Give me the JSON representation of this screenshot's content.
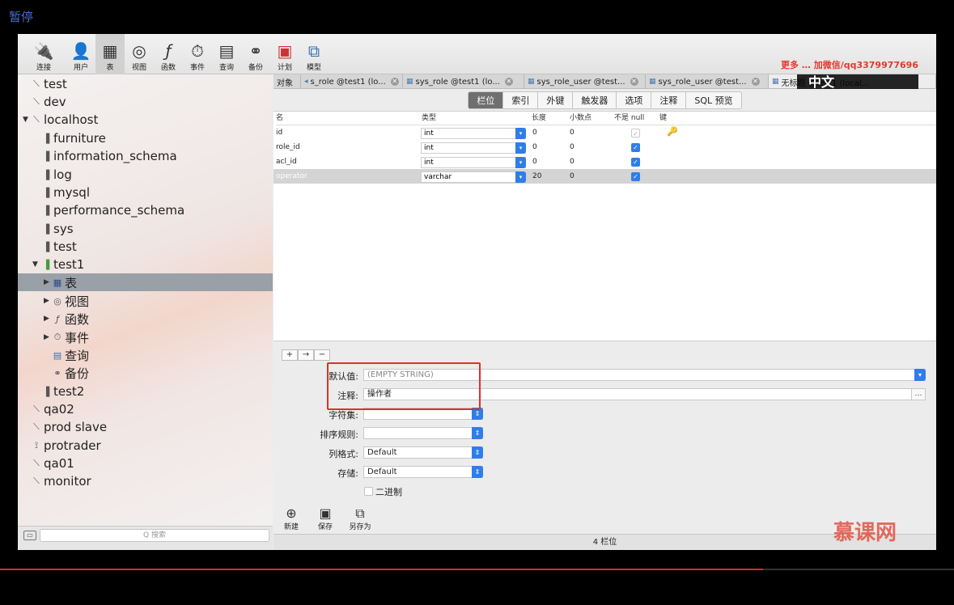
{
  "overlay": {
    "pause_label": "暂停",
    "progress": 0.8
  },
  "toolbar": {
    "items": [
      {
        "label": "连接",
        "icon": "connection-icon"
      },
      {
        "label": "用户",
        "icon": "user-icon"
      },
      {
        "label": "表",
        "icon": "table-icon"
      },
      {
        "label": "视图",
        "icon": "view-icon"
      },
      {
        "label": "函数",
        "icon": "function-icon"
      },
      {
        "label": "事件",
        "icon": "event-icon"
      },
      {
        "label": "查询",
        "icon": "query-icon"
      },
      {
        "label": "备份",
        "icon": "backup-icon"
      },
      {
        "label": "计划",
        "icon": "schedule-icon"
      },
      {
        "label": "模型",
        "icon": "model-icon"
      }
    ],
    "promo_text": "更多 … 加微信/qq3379977696"
  },
  "sidebar": {
    "items": [
      {
        "label": "test"
      },
      {
        "label": "dev"
      },
      {
        "label": "localhost"
      },
      {
        "label": "furniture"
      },
      {
        "label": "information_schema"
      },
      {
        "label": "log"
      },
      {
        "label": "mysql"
      },
      {
        "label": "performance_schema"
      },
      {
        "label": "sys"
      },
      {
        "label": "test"
      },
      {
        "label": "test1"
      },
      {
        "label": "表"
      },
      {
        "label": "视图"
      },
      {
        "label": "函数"
      },
      {
        "label": "事件"
      },
      {
        "label": "查询"
      },
      {
        "label": "备份"
      },
      {
        "label": "test2"
      },
      {
        "label": "qa02"
      },
      {
        "label": "prod slave"
      },
      {
        "label": "protrader"
      },
      {
        "label": "qa01"
      },
      {
        "label": "monitor"
      }
    ],
    "search_placeholder": "Q 搜索"
  },
  "tabs": [
    {
      "label": "对象"
    },
    {
      "label": "s_role @test1 (lo..."
    },
    {
      "label": "sys_role @test1 (lo..."
    },
    {
      "label": "sys_role_user @test..."
    },
    {
      "label": "sys_role_user @test..."
    },
    {
      "label": "无标题 @test1 (local..."
    }
  ],
  "badge": "中文",
  "segments": [
    "栏位",
    "索引",
    "外键",
    "触发器",
    "选项",
    "注释",
    "SQL 预览"
  ],
  "grid": {
    "headers": [
      "名",
      "类型",
      "长度",
      "小数点",
      "不是 null",
      "键"
    ],
    "rows": [
      {
        "name": "id",
        "type": "int",
        "length": "0",
        "decimals": "0",
        "not_null": true,
        "key": true
      },
      {
        "name": "role_id",
        "type": "int",
        "length": "0",
        "decimals": "0",
        "not_null": true,
        "key": false
      },
      {
        "name": "acl_id",
        "type": "int",
        "length": "0",
        "decimals": "0",
        "not_null": true,
        "key": false
      },
      {
        "name": "operator",
        "type": "varchar",
        "length": "20",
        "decimals": "0",
        "not_null": true,
        "key": false
      }
    ]
  },
  "edit_buttons": {
    "add": "+",
    "insert": "→",
    "remove": "−"
  },
  "props": {
    "default_label": "默认值:",
    "default_value": "(EMPTY STRING)",
    "comment_label": "注释:",
    "comment_value": "操作者",
    "charset_label": "字符集:",
    "collation_label": "排序规则:",
    "format_label": "列格式:",
    "format_value": "Default",
    "storage_label": "存储:",
    "storage_value": "Default",
    "binary_label": "二进制"
  },
  "bottom_tools": [
    {
      "label": "新建",
      "icon": "new-icon"
    },
    {
      "label": "保存",
      "icon": "save-icon"
    },
    {
      "label": "另存为",
      "icon": "save-as-icon"
    }
  ],
  "status": "4 栏位",
  "brand": "慕课网"
}
